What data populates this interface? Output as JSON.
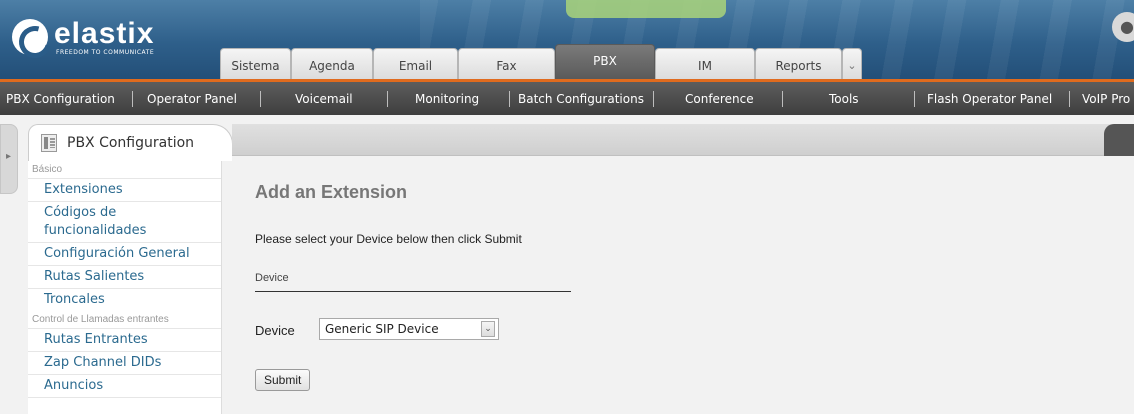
{
  "brand": {
    "name": "elastix",
    "tagline": "FREEDOM TO COMMUNICATE",
    "accent": "#e06b1e"
  },
  "main_tabs": [
    {
      "label": "Sistema",
      "active": false
    },
    {
      "label": "Agenda",
      "active": false
    },
    {
      "label": "Email",
      "active": false
    },
    {
      "label": "Fax",
      "active": false
    },
    {
      "label": "PBX",
      "active": true
    },
    {
      "label": "IM",
      "active": false
    },
    {
      "label": "Reports",
      "active": false
    }
  ],
  "more_tabs_icon": "chevron-down-icon",
  "sub_nav": [
    "PBX Configuration",
    "Operator Panel",
    "Voicemail",
    "Monitoring",
    "Batch Configurations",
    "Conference",
    "Tools",
    "Flash Operator Panel",
    "VoIP Pro"
  ],
  "module": {
    "title": "PBX Configuration",
    "icon": "module-icon"
  },
  "sidebar": {
    "sections": [
      {
        "heading": "Básico",
        "items": [
          "Extensiones",
          "Códigos de funcionalidades",
          "Configuración General",
          "Rutas Salientes",
          "Troncales"
        ]
      },
      {
        "heading": "Control de Llamadas entrantes",
        "items": [
          "Rutas Entrantes",
          "Zap Channel DIDs",
          "Anuncios"
        ]
      }
    ]
  },
  "form": {
    "title": "Add an Extension",
    "instructions": "Please select your Device below then click Submit",
    "section_label": "Device",
    "device_label": "Device",
    "device_value": "Generic SIP Device",
    "submit_label": "Submit"
  }
}
